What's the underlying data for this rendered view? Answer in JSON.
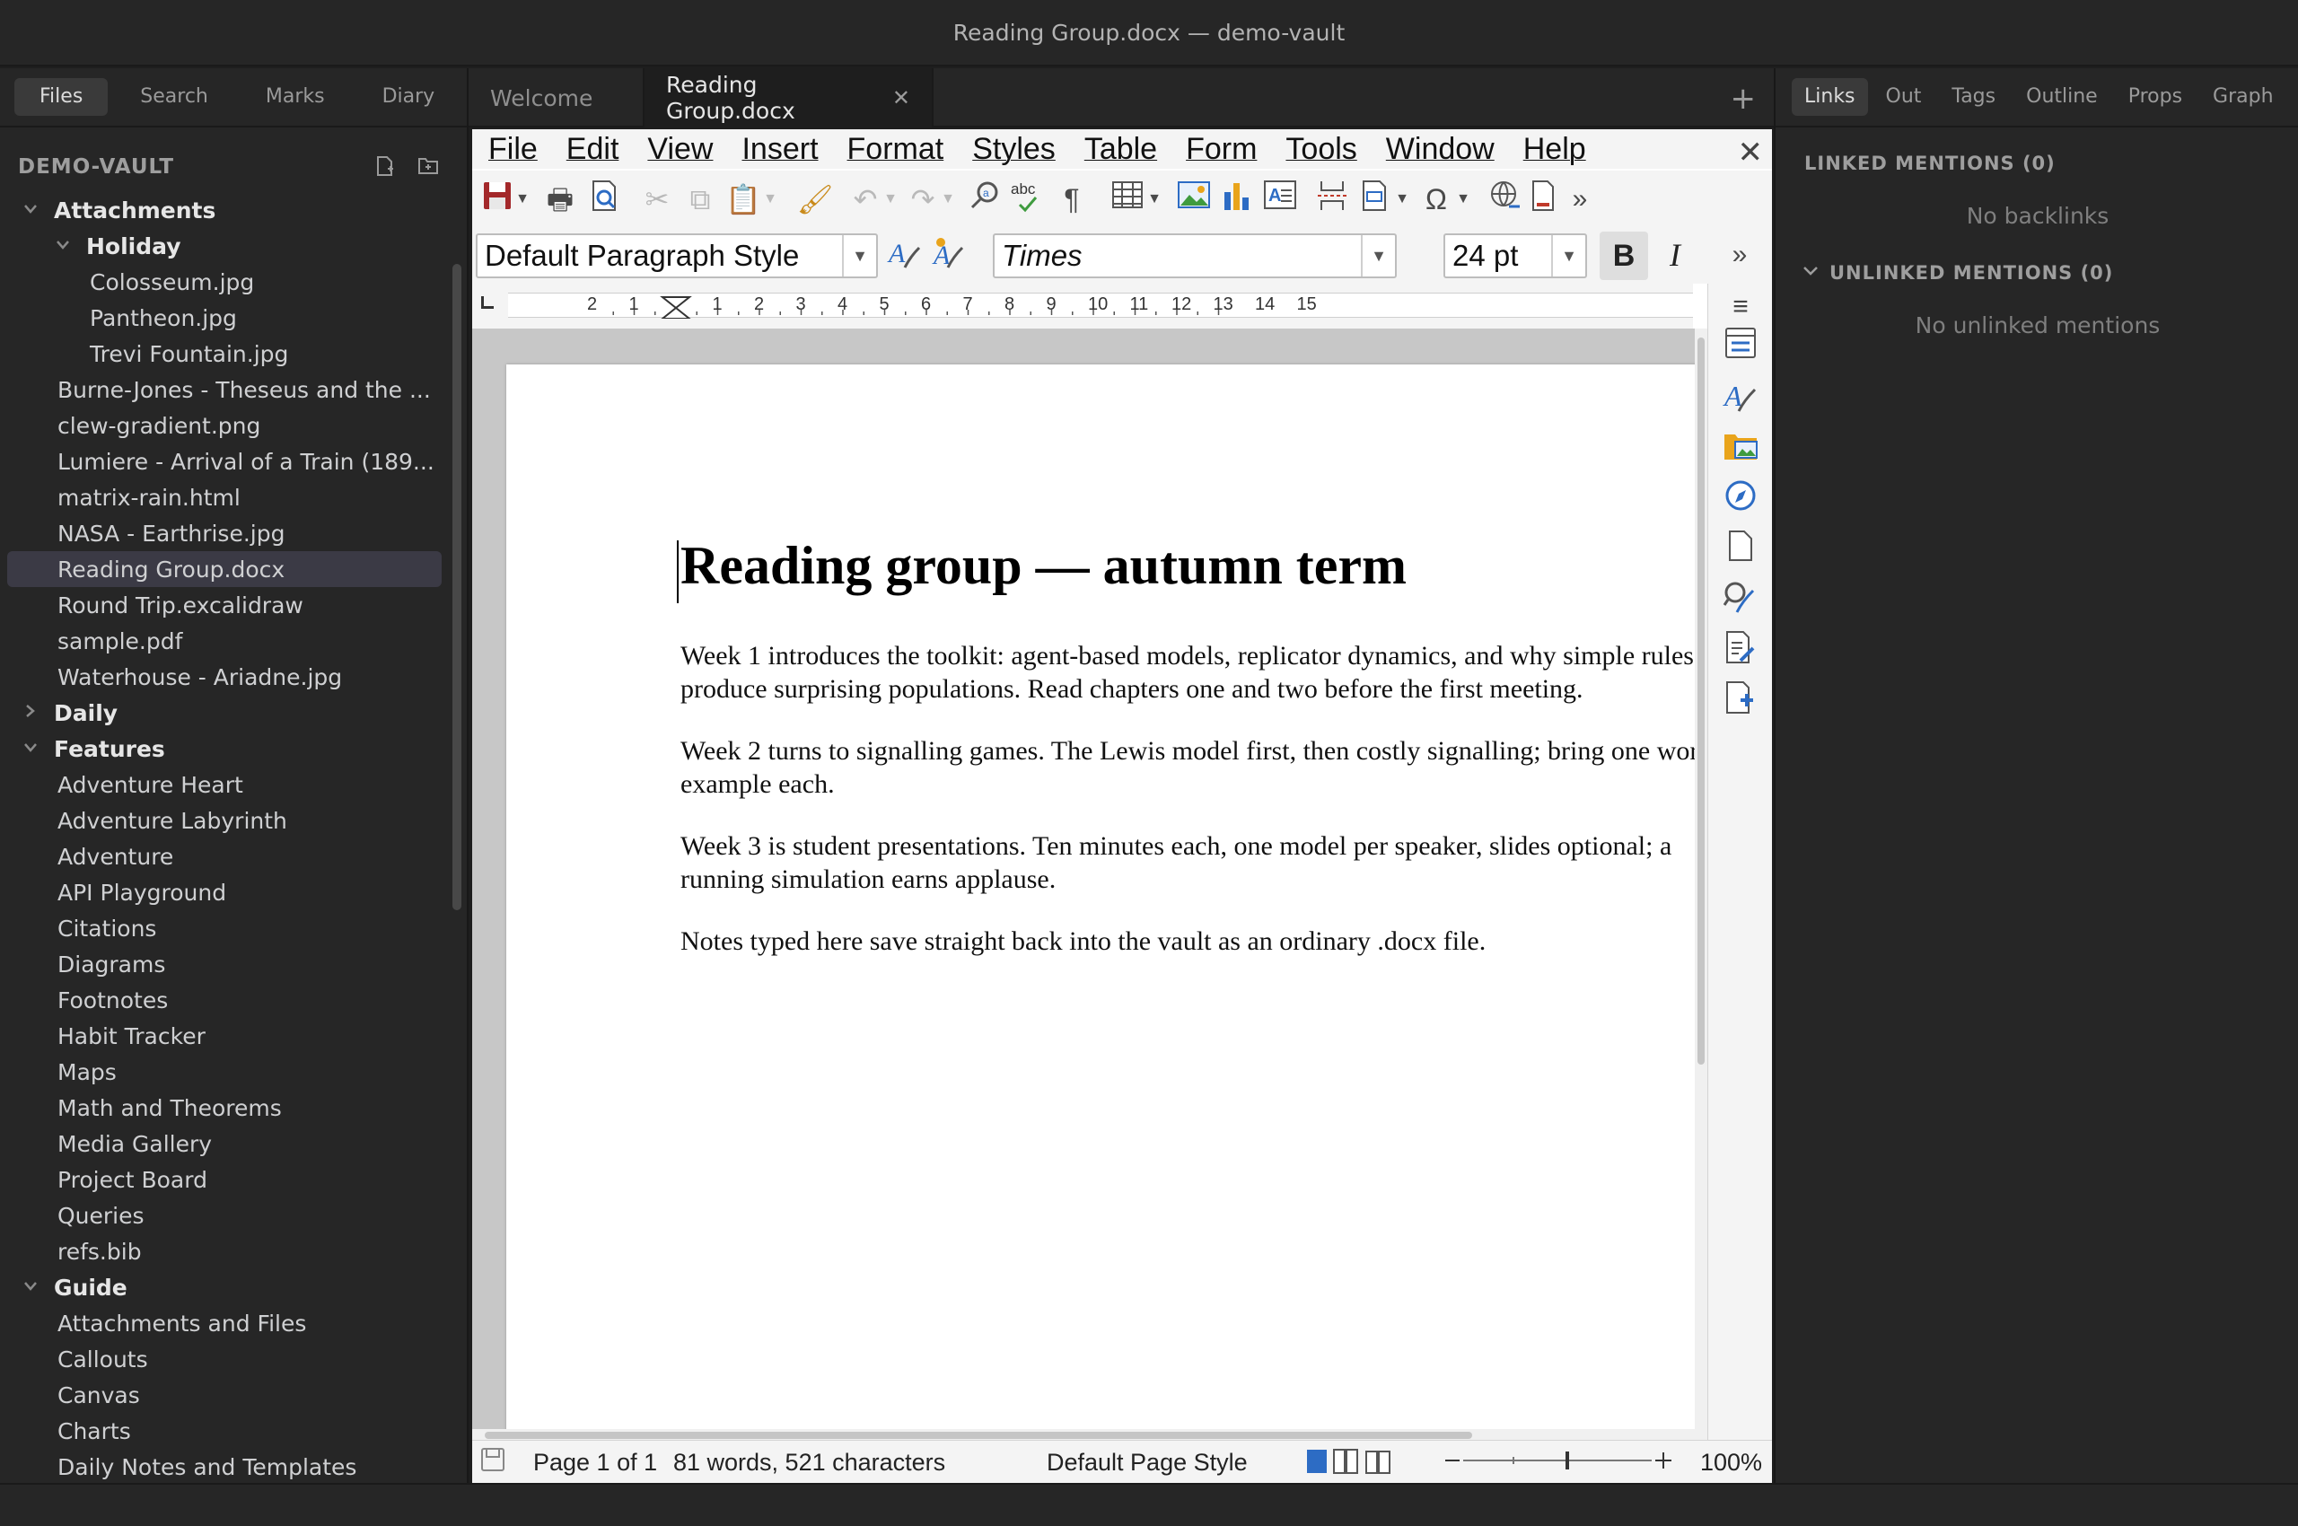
{
  "window": {
    "title": "Reading Group.docx — demo-vault"
  },
  "left_sidebar": {
    "tabs": [
      {
        "label": "Files",
        "active": true
      },
      {
        "label": "Search",
        "active": false
      },
      {
        "label": "Marks",
        "active": false
      },
      {
        "label": "Diary",
        "active": false
      }
    ],
    "vault_name": "DEMO-VAULT",
    "tree": [
      {
        "label": "Attachments",
        "type": "folder",
        "depth": 0,
        "expanded": true
      },
      {
        "label": "Holiday",
        "type": "folder",
        "depth": 1,
        "expanded": true
      },
      {
        "label": "Colosseum.jpg",
        "type": "file",
        "depth": 2
      },
      {
        "label": "Pantheon.jpg",
        "type": "file",
        "depth": 2
      },
      {
        "label": "Trevi Fountain.jpg",
        "type": "file",
        "depth": 2
      },
      {
        "label": "Burne-Jones - Theseus and the ...",
        "type": "file",
        "depth": 1
      },
      {
        "label": "clew-gradient.png",
        "type": "file",
        "depth": 1
      },
      {
        "label": "Lumiere - Arrival of a Train (189...",
        "type": "file",
        "depth": 1
      },
      {
        "label": "matrix-rain.html",
        "type": "file",
        "depth": 1
      },
      {
        "label": "NASA - Earthrise.jpg",
        "type": "file",
        "depth": 1
      },
      {
        "label": "Reading Group.docx",
        "type": "file",
        "depth": 1,
        "selected": true
      },
      {
        "label": "Round Trip.excalidraw",
        "type": "file",
        "depth": 1
      },
      {
        "label": "sample.pdf",
        "type": "file",
        "depth": 1
      },
      {
        "label": "Waterhouse - Ariadne.jpg",
        "type": "file",
        "depth": 1
      },
      {
        "label": "Daily",
        "type": "folder",
        "depth": 0,
        "expanded": false
      },
      {
        "label": "Features",
        "type": "folder",
        "depth": 0,
        "expanded": true
      },
      {
        "label": "Adventure Heart",
        "type": "file",
        "depth": 1
      },
      {
        "label": "Adventure Labyrinth",
        "type": "file",
        "depth": 1
      },
      {
        "label": "Adventure",
        "type": "file",
        "depth": 1
      },
      {
        "label": "API Playground",
        "type": "file",
        "depth": 1
      },
      {
        "label": "Citations",
        "type": "file",
        "depth": 1
      },
      {
        "label": "Diagrams",
        "type": "file",
        "depth": 1
      },
      {
        "label": "Footnotes",
        "type": "file",
        "depth": 1
      },
      {
        "label": "Habit Tracker",
        "type": "file",
        "depth": 1
      },
      {
        "label": "Maps",
        "type": "file",
        "depth": 1
      },
      {
        "label": "Math and Theorems",
        "type": "file",
        "depth": 1
      },
      {
        "label": "Media Gallery",
        "type": "file",
        "depth": 1
      },
      {
        "label": "Project Board",
        "type": "file",
        "depth": 1
      },
      {
        "label": "Queries",
        "type": "file",
        "depth": 1
      },
      {
        "label": "refs.bib",
        "type": "file",
        "depth": 1
      },
      {
        "label": "Guide",
        "type": "folder",
        "depth": 0,
        "expanded": true
      },
      {
        "label": "Attachments and Files",
        "type": "file",
        "depth": 1
      },
      {
        "label": "Callouts",
        "type": "file",
        "depth": 1
      },
      {
        "label": "Canvas",
        "type": "file",
        "depth": 1
      },
      {
        "label": "Charts",
        "type": "file",
        "depth": 1
      },
      {
        "label": "Daily Notes and Templates",
        "type": "file",
        "depth": 1
      }
    ]
  },
  "editor_tabs": [
    {
      "label": "Welcome",
      "active": false
    },
    {
      "label": "Reading Group.docx",
      "active": true
    }
  ],
  "office": {
    "menu": [
      "File",
      "Edit",
      "View",
      "Insert",
      "Format",
      "Styles",
      "Table",
      "Form",
      "Tools",
      "Window",
      "Help"
    ],
    "paragraph_style": "Default Paragraph Style",
    "font_name": "Times",
    "font_size": "24 pt",
    "ruler_numbers": [
      "2",
      "1",
      "1",
      "2",
      "3",
      "4",
      "5",
      "6",
      "7",
      "8",
      "9",
      "10",
      "11",
      "12",
      "13",
      "14",
      "15"
    ],
    "document": {
      "title": "Reading group — autumn term",
      "paragraphs": [
        "Week 1 introduces the toolkit: agent-based models, replicator dynamics, and why simple rules produce surprising populations. Read chapters one and two before the first meeting.",
        "Week 2 turns to signalling games. The Lewis model first, then costly signalling; bring one worked example each.",
        "Week 3 is student presentations. Ten minutes each, one model per speaker, slides optional; a running simulation earns applause.",
        "Notes typed here save straight back into the vault as an ordinary .docx file."
      ]
    },
    "status": {
      "page": "Page 1 of 1",
      "counts": "81 words, 521 characters",
      "page_style": "Default Page Style",
      "zoom": "100%"
    }
  },
  "right_sidebar": {
    "tabs": [
      {
        "label": "Links",
        "active": true
      },
      {
        "label": "Out",
        "active": false
      },
      {
        "label": "Tags",
        "active": false
      },
      {
        "label": "Outline",
        "active": false
      },
      {
        "label": "Props",
        "active": false
      },
      {
        "label": "Graph",
        "active": false
      }
    ],
    "linked_heading": "LINKED MENTIONS (0)",
    "linked_empty": "No backlinks",
    "unlinked_heading": "UNLINKED MENTIONS (0)",
    "unlinked_empty": "No unlinked mentions"
  }
}
